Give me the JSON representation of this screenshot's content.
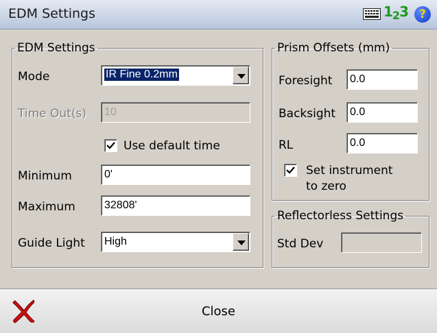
{
  "window": {
    "title": "EDM Settings"
  },
  "titlebar_icons": {
    "keyboard": "keyboard-icon",
    "input_mode": "123",
    "help": "?"
  },
  "edm": {
    "legend": "EDM Settings",
    "mode_label": "Mode",
    "mode_value": "IR Fine 0.2mm",
    "timeout_label": "Time Out(s)",
    "timeout_value": "10",
    "default_time_label": "Use default time",
    "default_time_checked": true,
    "minimum_label": "Minimum",
    "minimum_value": "0'",
    "maximum_label": "Maximum",
    "maximum_value": "32808'",
    "guide_light_label": "Guide Light",
    "guide_light_value": "High"
  },
  "prism": {
    "legend": "Prism Offsets (mm)",
    "foresight_label": "Foresight",
    "foresight_value": "0.0",
    "backsight_label": "Backsight",
    "backsight_value": "0.0",
    "rl_label": "RL",
    "rl_value": "0.0",
    "zero_label_line1": "Set instrument",
    "zero_label_line2": "to zero",
    "zero_checked": true
  },
  "reflectorless": {
    "legend": "Reflectorless Settings",
    "stddev_label": "Std Dev",
    "stddev_value": ""
  },
  "footer": {
    "close_label": "Close"
  },
  "colors": {
    "accent": "#0a246a",
    "title_bg": "#c9d4e6",
    "dialog_bg": "#d4d0c8",
    "close_red": "#cc1111"
  }
}
